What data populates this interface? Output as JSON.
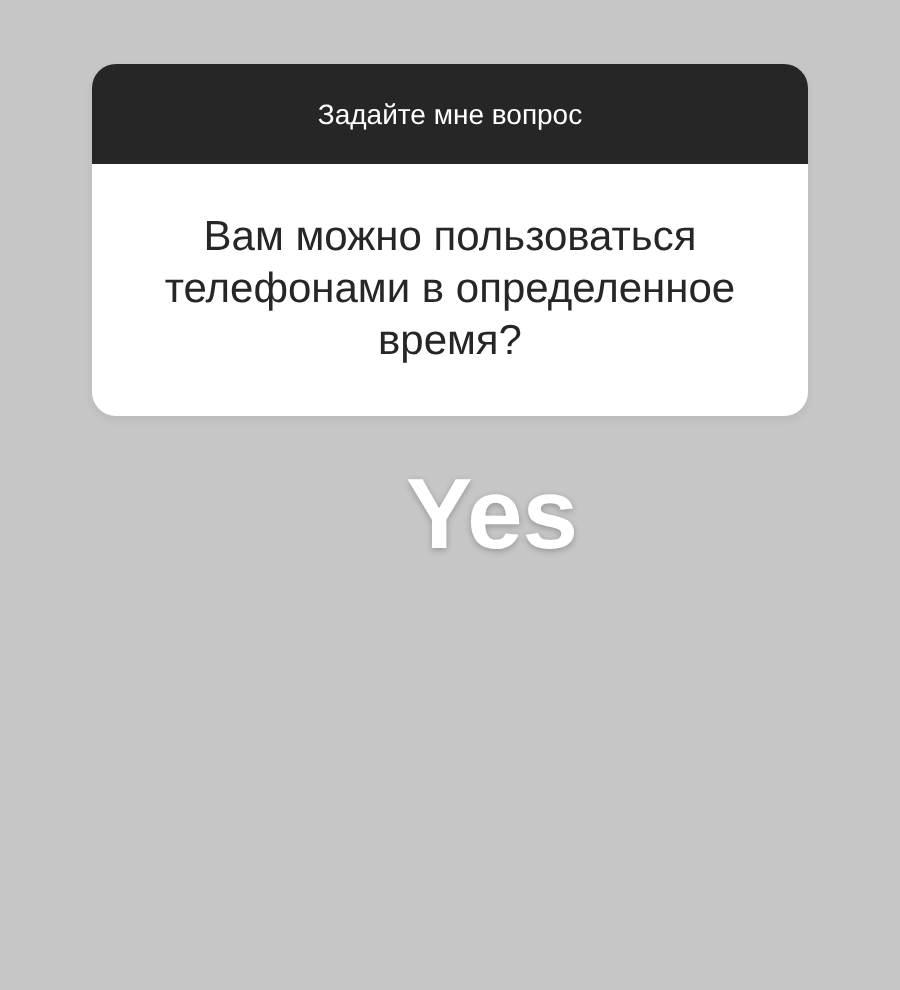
{
  "question_sticker": {
    "title": "Задайте мне вопрос",
    "question": "Вам можно пользоваться телефонами в определенное время?"
  },
  "answer_text": "Yes"
}
